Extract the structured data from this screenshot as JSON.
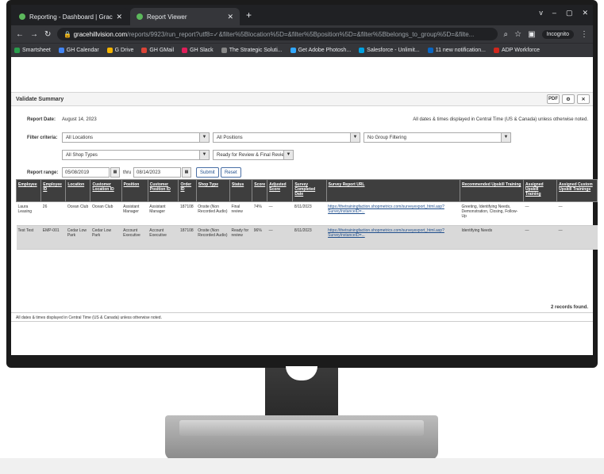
{
  "browser": {
    "tabs": [
      {
        "title": "Reporting - Dashboard | Grace H"
      },
      {
        "title": "Report Viewer"
      }
    ],
    "new_tab": "+",
    "window_controls": [
      "v",
      "–",
      "▢",
      "✕"
    ],
    "url_domain": "gracehillvision.com",
    "url_path": "/reports/9923/run_report?utf8=✓&filter%5Blocation%5D=&filter%5Bposition%5D=&filter%5Bbelongs_to_group%5D=&filte...",
    "incognito_label": "Incognito",
    "bookmarks": [
      {
        "label": "Smartsheet",
        "color": "#2a9d4c"
      },
      {
        "label": "GH Calendar",
        "color": "#4285f4"
      },
      {
        "label": "G Drive",
        "color": "#f4b400"
      },
      {
        "label": "GH GMail",
        "color": "#db4437"
      },
      {
        "label": "GH Slack",
        "color": "#e01e5a"
      },
      {
        "label": "The Strategic Soluti...",
        "color": "#888888"
      },
      {
        "label": "Get Adobe Photosh...",
        "color": "#31a8ff"
      },
      {
        "label": "Salesforce - Unlimit...",
        "color": "#00a1e0"
      },
      {
        "label": "11 new notification...",
        "color": "#0a66c2"
      },
      {
        "label": "ADP Workforce",
        "color": "#d0271d"
      }
    ]
  },
  "report": {
    "title": "Validate Summary",
    "icons": [
      "PDF",
      "⚙",
      "✕"
    ],
    "report_date_label": "Report Date:",
    "report_date": "August 14, 2023",
    "timezone_note": "All dates & times displayed in Central Time (US & Canada) unless otherwise noted.",
    "filter_label": "Filter criteria:",
    "filters": {
      "location": "All Locations",
      "position": "All Positions",
      "group": "No Group Filtering",
      "shop_types": "All Shop Types",
      "status": "Ready for Review & Final Review"
    },
    "range_label": "Report range:",
    "range_from": "05/08/2019",
    "range_thru_label": "thru",
    "range_to": "08/14/2023",
    "submit_label": "Submit",
    "reset_label": "Reset",
    "columns": [
      "Employee",
      "Employee ID",
      "Location",
      "Customer Location ID",
      "Position",
      "Customer Position ID",
      "Order ID",
      "Shop Type",
      "Status",
      "Score",
      "Adjusted Score",
      "Survey Completed Date",
      "Survey Report URL",
      "Recommended Upskill Training",
      "Assigned Upskill Training",
      "Assigned Custom Upskill Trainings"
    ],
    "rows": [
      [
        "Laura Leasing",
        "26",
        "Ocean Club",
        "Ocean Club",
        "Assistant Manager",
        "Assistant Manager",
        "187108",
        "Onsite (Non Recorded Audio)",
        "Final review",
        "74%",
        "—",
        "8/11/2023",
        "https://thetrainingfaction.shopmetrics.com/surveyexport_html.asp?SurveyInstanceID=...",
        "Greeting, Identifying Needs, Demonstration, Closing, Follow-Up",
        "—",
        "—"
      ],
      [
        "Test Test",
        "EMP-001",
        "Cedar Low Park",
        "Cedar Low Park",
        "Account Executive",
        "Account Executive",
        "187108",
        "Onsite (Non Recorded Audio)",
        "Ready for review",
        "96%",
        "—",
        "8/11/2023",
        "https://thetrainingfaction.shopmetrics.com/surveyexport_html.asp?SurveyInstanceID=...",
        "Identifying Needs",
        "—",
        "—"
      ]
    ],
    "records_found": "2 records found.",
    "footer_note": "All dates & times displayed in Central Time (US & Canada) unless otherwise noted."
  }
}
